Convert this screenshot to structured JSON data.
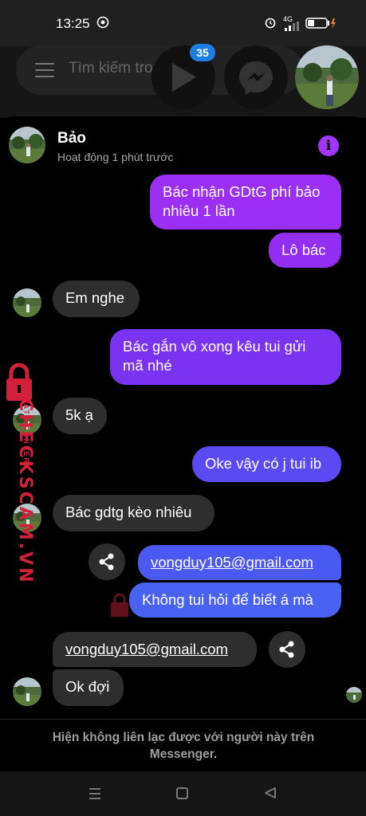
{
  "status_bar": {
    "time": "13:25",
    "network": "4G",
    "battery_icon": "battery-icon"
  },
  "search": {
    "placeholder": "Tìm kiếm trong"
  },
  "chat_heads": {
    "video_badge_count": "35"
  },
  "chat": {
    "contact_name": "Bảo",
    "contact_status": "Hoạt động 1 phút trước"
  },
  "messages": [
    {
      "dir": "out",
      "text_line1": "Bác nhận GDtG phí bảo",
      "text_line2": "nhiêu 1 lần"
    },
    {
      "dir": "out",
      "text": "Lô bác"
    },
    {
      "dir": "in",
      "text": "Em nghe"
    },
    {
      "dir": "out",
      "text_line1": "Bác gắn vô xong kêu tui gửi",
      "text_line2": "mã nhé"
    },
    {
      "dir": "in",
      "text": "5k ạ"
    },
    {
      "dir": "out",
      "text": "Oke vậy có j tui ib"
    },
    {
      "dir": "in",
      "text": "Bác gdtg kèo nhiêu"
    },
    {
      "dir": "out",
      "text": "vongduy105@gmail.com",
      "is_link": true
    },
    {
      "dir": "out",
      "text": "Không tui hỏi để biết á mà"
    },
    {
      "dir": "in",
      "text": "vongduy105@gmail.com",
      "is_link": true
    },
    {
      "dir": "in",
      "text": "Ok đợi"
    }
  ],
  "watermark": {
    "brand": "CHECKSCAM.VN",
    "sub": "DATA CENTER"
  },
  "footer": {
    "line1": "Hiện không liên lạc được với người này trên",
    "line2": "Messenger."
  },
  "colors": {
    "accent_purple": "#a334fa",
    "out_bubble_top": "#a033ee",
    "out_bubble_bottom": "#4a61f0",
    "in_bubble": "#2e2e2e"
  }
}
